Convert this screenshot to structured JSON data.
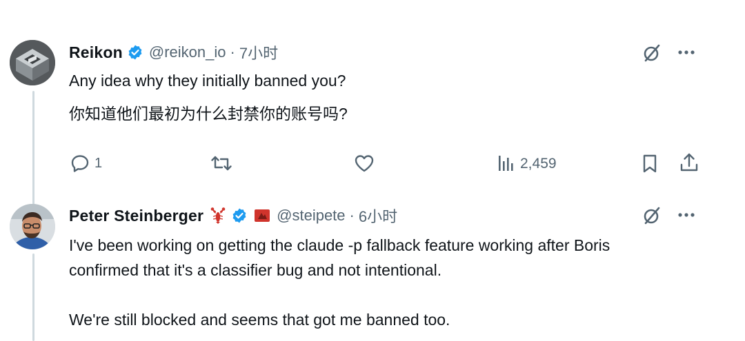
{
  "tweet1": {
    "name": "Reikon",
    "handle": "@reikon_io",
    "dot": "·",
    "time": "7小时",
    "text_en": "Any idea why they initially banned you?",
    "text_zh": "你知道他们最初为什么封禁你的账号吗?",
    "reply_count": "1",
    "views": "2,459"
  },
  "tweet2": {
    "name": "Peter Steinberger",
    "handle": "@steipete",
    "dot": "·",
    "time": "6小时",
    "text_line1": "I've been working on getting the claude -p fallback feature working after Boris",
    "text_line2": "confirmed that it's a classifier bug and not intentional.",
    "text_line3": "We're still blocked and seems that got me banned too."
  },
  "colors": {
    "verified": "#1d9bf0",
    "text": "#0f1419",
    "secondary": "#536471",
    "lobster": "#d0342c"
  },
  "icons": {
    "reply": "reply-icon",
    "retweet": "retweet-icon",
    "like": "heart-icon",
    "views": "views-icon",
    "bookmark": "bookmark-icon",
    "share": "share-icon",
    "grok": "grok-icon",
    "more": "more-icon"
  }
}
